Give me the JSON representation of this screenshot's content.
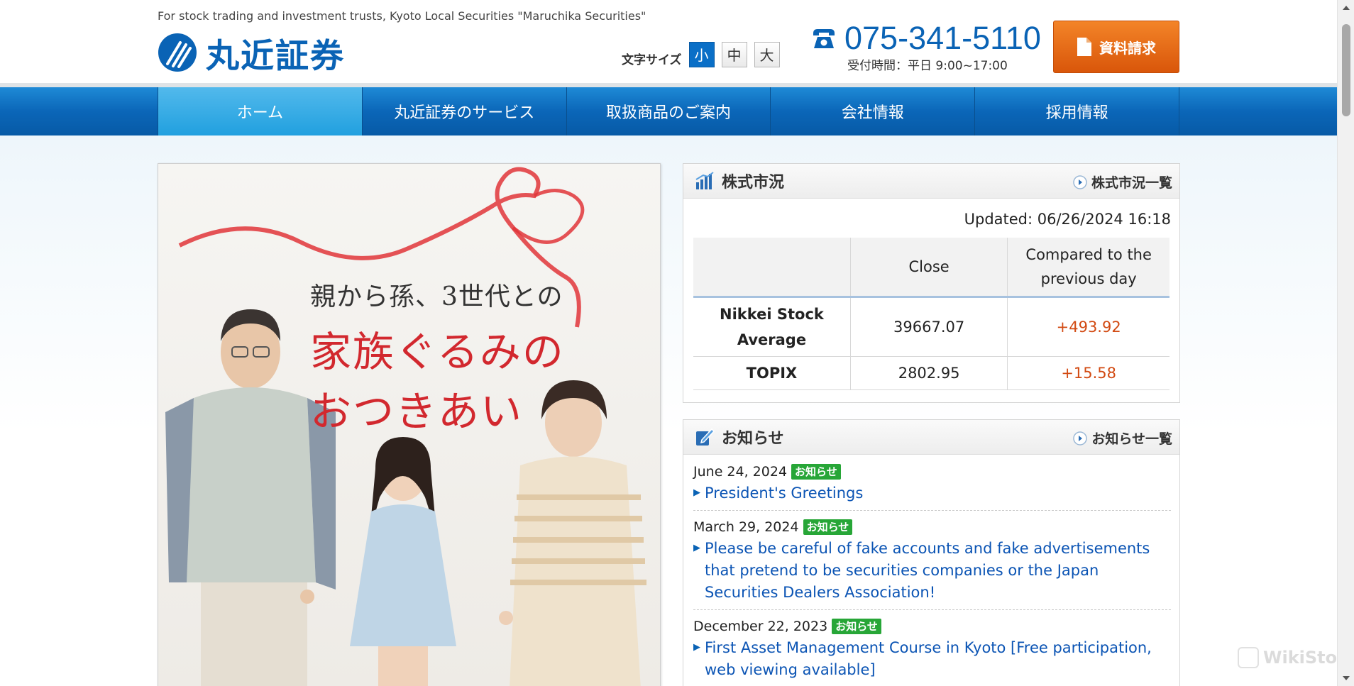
{
  "header": {
    "tagline": "For stock trading and investment trusts, Kyoto Local Securities \"Maruchika Securities\"",
    "logo_text": "丸近証券",
    "font_size_label": "文字サイズ",
    "font_sizes": [
      "小",
      "中",
      "大"
    ],
    "font_size_selected": "小",
    "phone_number": "075-341-5110",
    "hours": "受付時間：平日 9:00~17:00",
    "request_button": "資料請求"
  },
  "nav": {
    "items": [
      "ホーム",
      "丸近証券のサービス",
      "取扱商品のご案内",
      "会社情報",
      "採用情報"
    ],
    "active": "ホーム"
  },
  "banner": {
    "line1": "親から孫、3世代との",
    "line2": "家族ぐるみの",
    "line3": "おつきあい"
  },
  "market": {
    "title": "株式市況",
    "link": "株式市況一覧",
    "updated": "Updated: 06/26/2024 16:18",
    "columns": [
      "",
      "Close",
      "Compared to the previous day"
    ],
    "rows": [
      {
        "name": "Nikkei Stock Average",
        "close": "39667.07",
        "change": "+493.92"
      },
      {
        "name": "TOPIX",
        "close": "2802.95",
        "change": "+15.58"
      }
    ]
  },
  "news": {
    "title": "お知らせ",
    "link": "お知らせ一覧",
    "items": [
      {
        "date": "June 24, 2024",
        "badge": "お知らせ",
        "title": "President's Greetings"
      },
      {
        "date": "March 29, 2024",
        "badge": "お知らせ",
        "title": "Please be careful of fake accounts and fake advertisements that pretend to be securities companies or the Japan Securities Dealers Association!"
      },
      {
        "date": "December 22, 2023",
        "badge": "お知らせ",
        "title": "First Asset Management Course in Kyoto [Free participation, web viewing available]"
      }
    ]
  },
  "watermark": "WikiStock",
  "colors": {
    "brand_blue": "#0a63b5",
    "nav_blue": "#0b66b8",
    "orange": "#e2661a",
    "positive_change": "#d24a12",
    "badge_green": "#27a637",
    "banner_red": "#d2282e"
  }
}
